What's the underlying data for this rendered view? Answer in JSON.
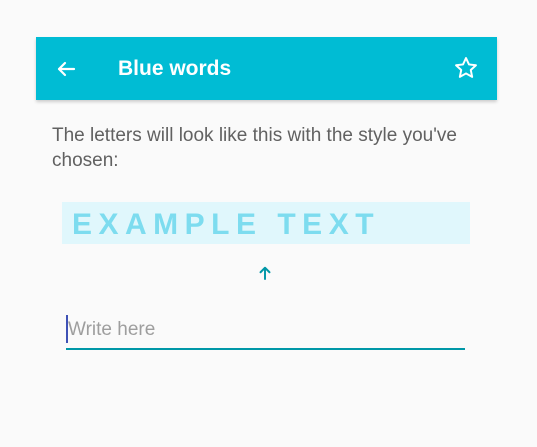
{
  "app_bar": {
    "title": "Blue words",
    "back_icon": "arrow-back-icon",
    "favorite_icon": "star-outline-icon",
    "background_color": "#00bcd4"
  },
  "main": {
    "description": "The letters will look like this with the style you've chosen:",
    "preview_text": "EXAMPLE TEXT",
    "preview_text_color": "#7ddcef",
    "preview_background_color": "#e0f7fc",
    "arrow_icon": "arrow-up-icon",
    "input": {
      "value": "",
      "placeholder": "Write here"
    },
    "accent_color": "#0097a7"
  }
}
